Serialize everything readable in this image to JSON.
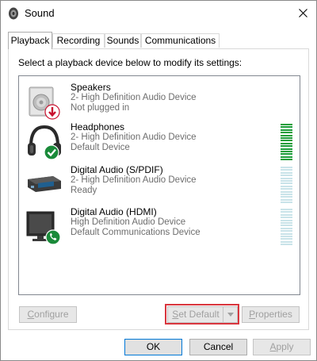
{
  "window": {
    "title": "Sound",
    "icon": "speaker-icon",
    "close_icon": "close-icon"
  },
  "tabs": [
    {
      "label": "Playback",
      "active": true
    },
    {
      "label": "Recording",
      "active": false
    },
    {
      "label": "Sounds",
      "active": false
    },
    {
      "label": "Communications",
      "active": false
    }
  ],
  "instruction": "Select a playback device below to modify its settings:",
  "devices": [
    {
      "name": "Speakers",
      "line1": "2- High Definition Audio Device",
      "line2": "Not plugged in",
      "icon": "speaker-device-icon",
      "badge": "red-down-arrow-icon",
      "meter": "none"
    },
    {
      "name": "Headphones",
      "line1": "2- High Definition Audio Device",
      "line2": "Default Device",
      "icon": "headphones-icon",
      "badge": "green-checkmark-icon",
      "meter": "active",
      "level": 1.0
    },
    {
      "name": "Digital Audio (S/PDIF)",
      "line1": "2- High Definition Audio Device",
      "line2": "Ready",
      "icon": "spdif-device-icon",
      "badge": "",
      "meter": "idle",
      "level": 0.0
    },
    {
      "name": "Digital Audio (HDMI)",
      "line1": "High Definition Audio Device",
      "line2": "Default Communications Device",
      "icon": "monitor-icon",
      "badge": "green-phone-icon",
      "meter": "idle",
      "level": 0.0
    }
  ],
  "buttons": {
    "configure": {
      "label": "Configure",
      "accel": "C",
      "rest": "onfigure"
    },
    "set_default": {
      "label": "Set Default",
      "accel": "S",
      "rest": "et Default"
    },
    "properties": {
      "label": "Properties",
      "accel": "P",
      "rest": "roperties"
    },
    "ok": "OK",
    "cancel": "Cancel",
    "apply": {
      "label": "Apply",
      "accel": "A",
      "rest": "pply"
    }
  },
  "colors": {
    "highlight": "#d9363e",
    "meter_active": "#1e9e3c",
    "meter_idle": "#c9e3e9",
    "badge_green": "#1a8a3a",
    "badge_red": "#c8102e"
  }
}
